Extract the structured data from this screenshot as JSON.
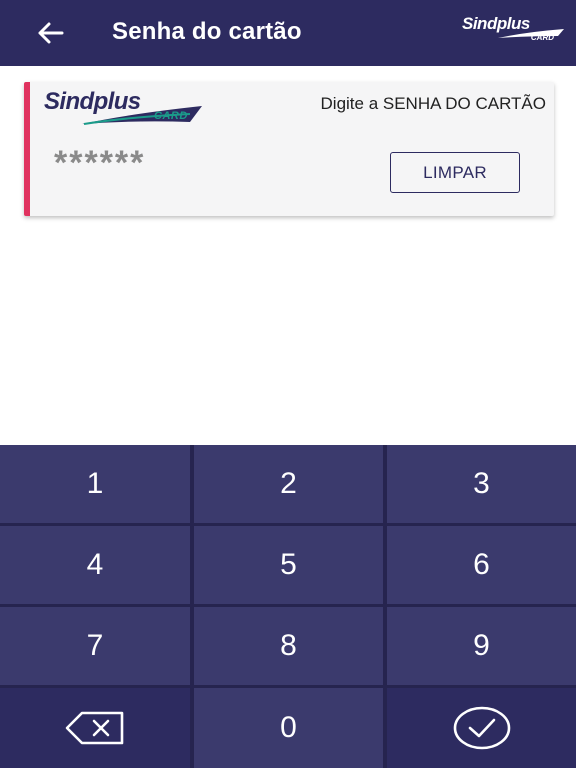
{
  "header": {
    "title": "Senha do cartão",
    "logo_text": "Sindplus",
    "logo_sub": "CARD"
  },
  "card": {
    "logo_text": "Sindplus",
    "logo_sub": "CARD",
    "prompt": "Digite a SENHA DO CARTÃO",
    "password_mask": "******",
    "clear_label": "LIMPAR"
  },
  "keypad": {
    "keys": [
      "1",
      "2",
      "3",
      "4",
      "5",
      "6",
      "7",
      "8",
      "9",
      "0"
    ]
  },
  "colors": {
    "header_bg": "#2d2b60",
    "accent": "#e0325f",
    "keypad_key": "#3b3a6d",
    "logo_teal": "#1b9b8a"
  }
}
